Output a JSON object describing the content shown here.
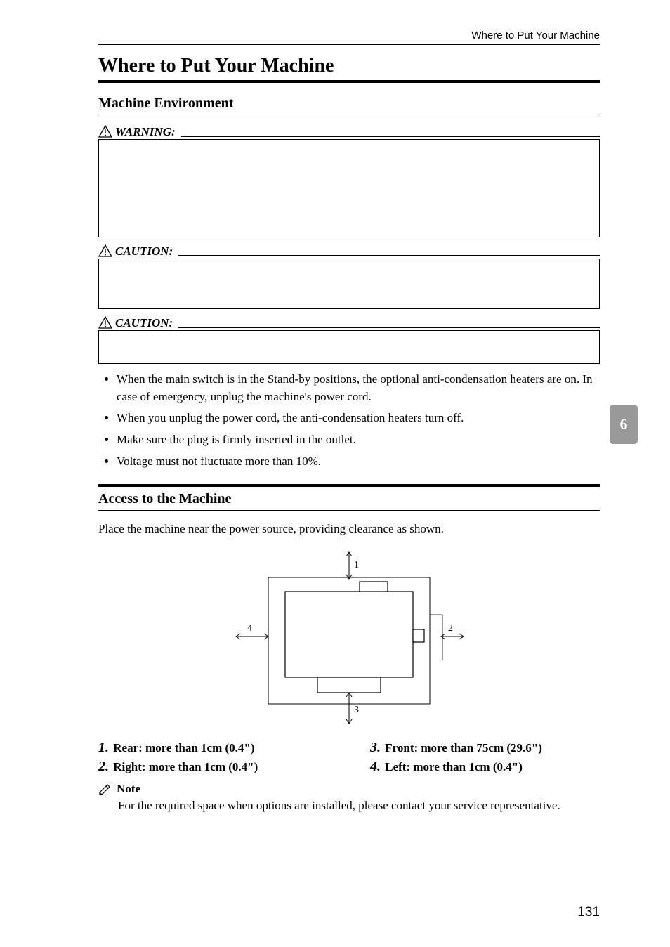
{
  "running_head": "Where to Put Your Machine",
  "h1": "Where to Put Your Machine",
  "h2a": "Machine Environment",
  "labels": {
    "warning": "WARNING:",
    "caution": "CAUTION:"
  },
  "bullets": [
    "When the main switch is in the Stand-by positions, the optional anti-condensation heaters are on. In case of emergency, unplug the machine's power cord.",
    "When you unplug the power cord, the anti-condensation heaters turn off.",
    "Make sure the plug is firmly inserted in the outlet.",
    "Voltage must not fluctuate more than 10%."
  ],
  "h2b": "Access to the Machine",
  "para": "Place the machine near the power source, providing clearance as shown.",
  "legend": {
    "r1": {
      "n": "1.",
      "t": "Rear: more than 1cm (0.4\")"
    },
    "r2": {
      "n": "2.",
      "t": "Right: more than 1cm (0.4\")"
    },
    "r3": {
      "n": "3.",
      "t": "Front: more than 75cm (29.6\")"
    },
    "r4": {
      "n": "4.",
      "t": "Left: more than 1cm (0.4\")"
    }
  },
  "note_label": "Note",
  "note_body": "For the required space when options are installed, please contact your service representative.",
  "tab": "6",
  "page_num": "131"
}
